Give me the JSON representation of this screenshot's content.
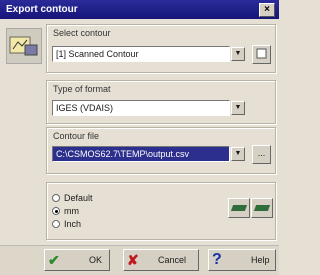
{
  "window": {
    "title": "Export contour",
    "close_glyph": "×"
  },
  "select_contour": {
    "label": "Select contour",
    "value": "[1] Scanned Contour"
  },
  "format": {
    "label": "Type of format",
    "value": "IGES (VDAIS)"
  },
  "contour_file": {
    "label": "Contour file",
    "value": "C:\\CSMOS62.7\\TEMP\\output.csv",
    "browse_label": "..."
  },
  "units": {
    "options": [
      {
        "label": "Default",
        "checked": false
      },
      {
        "label": "mm",
        "checked": true
      },
      {
        "label": "Inch",
        "checked": false
      }
    ]
  },
  "buttons": {
    "ok": "OK",
    "cancel": "Cancel",
    "help": "Help"
  },
  "icons": {
    "app": "export-contour-icon",
    "ok": "checkmark-icon",
    "cancel": "cross-icon",
    "help": "question-icon"
  },
  "colors": {
    "titlebar": "#1f1f8c",
    "ok_icon": "#2e8a2e",
    "cancel_icon": "#c01818",
    "help_icon": "#1a2ea8"
  }
}
